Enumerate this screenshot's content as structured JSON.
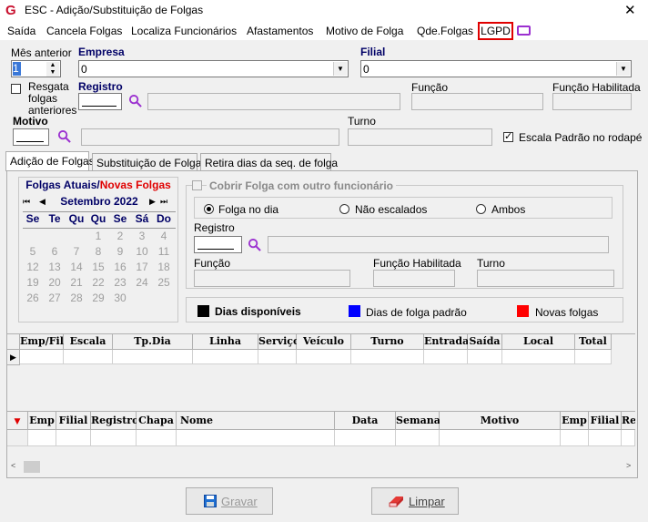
{
  "window": {
    "logo": "G",
    "title": "ESC - Adição/Substituição de Folgas",
    "close": "✕"
  },
  "menu": [
    "Saída",
    "Cancela Folgas",
    "Localiza Funcionários",
    "Afastamentos",
    "Motivo de Folga",
    "Qde.Folgas",
    "LGPD"
  ],
  "header": {
    "mes_anterior_label": "Mês anterior",
    "mes_anterior_value": "1",
    "empresa_label": "Empresa",
    "empresa_value": "0",
    "filial_label": "Filial",
    "filial_value": "0",
    "resgata_label": "Resgata folgas anteriores",
    "registro_label": "Registro",
    "funcao_label": "Função",
    "funcao_habilitada_label": "Função Habilitada",
    "motivo_label": "Motivo",
    "turno_label": "Turno",
    "escala_label": "Escala Padrão no rodapé"
  },
  "tabs": [
    "Adição de Folgas",
    "Substituição de Folgas",
    "Retira dias da seq. de folga"
  ],
  "calendar": {
    "title_atuais": "Folgas Atuais",
    "slash": "/",
    "title_novas": "Novas Folgas",
    "month": "Setembro 2022",
    "nav": {
      "first": "⏮",
      "prev": "◀",
      "next": "▶",
      "last": "⏭"
    },
    "weekdays": [
      "Se",
      "Te",
      "Qu",
      "Qu",
      "Se",
      "Sá",
      "Do"
    ],
    "weeks": [
      [
        "",
        "",
        "",
        "1",
        "2",
        "3",
        "4"
      ],
      [
        "5",
        "6",
        "7",
        "8",
        "9",
        "10",
        "11"
      ],
      [
        "12",
        "13",
        "14",
        "15",
        "16",
        "17",
        "18"
      ],
      [
        "19",
        "20",
        "21",
        "22",
        "23",
        "24",
        "25"
      ],
      [
        "26",
        "27",
        "28",
        "29",
        "30",
        "",
        ""
      ]
    ]
  },
  "cobrir": {
    "label": "Cobrir Folga com outro funcionário",
    "radios": [
      "Folga no dia",
      "Não escalados",
      "Ambos"
    ],
    "registro_label": "Registro",
    "funcao_label": "Função",
    "funcao_habilitada_label": "Função Habilitada",
    "turno_label": "Turno"
  },
  "legend": [
    {
      "label": "Dias disponíveis",
      "color": "#000000"
    },
    {
      "label": "Dias de folga padrão",
      "color": "#0000ff"
    },
    {
      "label": "Novas folgas",
      "color": "#ff0000"
    }
  ],
  "grid1": {
    "columns": [
      "Emp/Fil",
      "Escala",
      "Tp.Dia",
      "Linha",
      "Serviço",
      "Veículo",
      "Turno",
      "Entrada",
      "Saída",
      "Local",
      "Total"
    ]
  },
  "grid2": {
    "columns": [
      "Emp",
      "Filial",
      "Registro",
      "Chapa",
      "Nome",
      "Data",
      "Semana",
      "Motivo",
      "Emp",
      "Filial",
      "Re"
    ]
  },
  "buttons": {
    "gravar": "Gravar",
    "limpar": "Limpar"
  },
  "colors": {
    "accent_red": "#e00000",
    "navy": "#000066",
    "purple": "#9b30d0"
  }
}
